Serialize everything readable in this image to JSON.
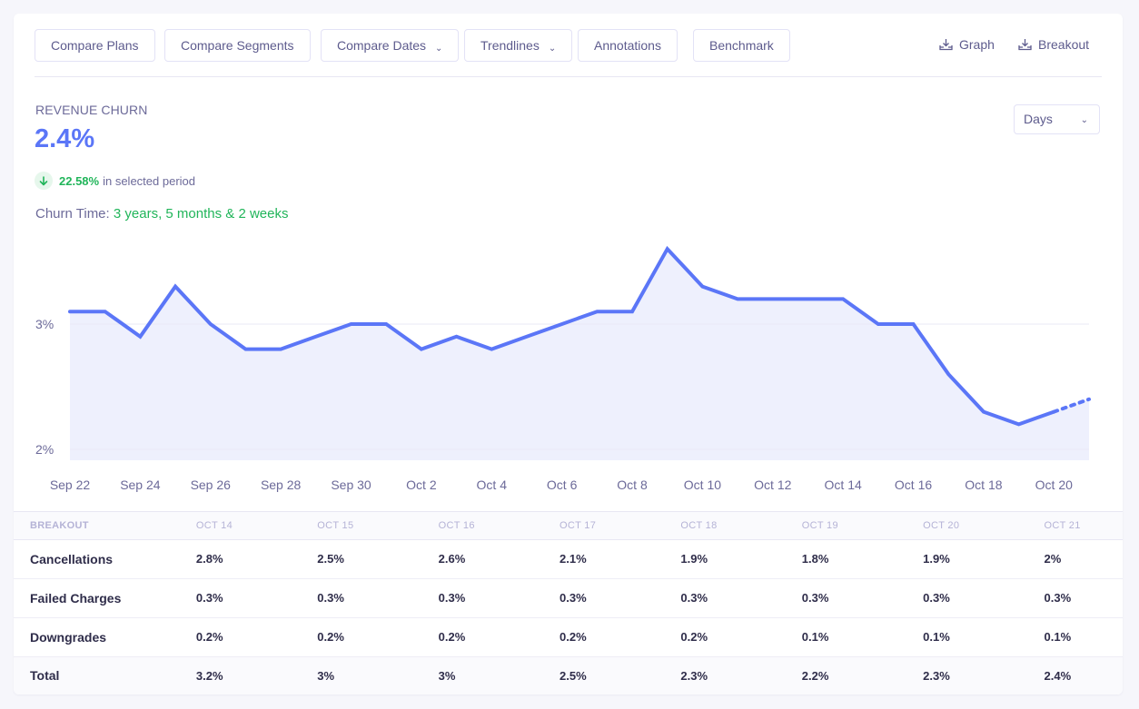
{
  "toolbar": {
    "buttons": [
      {
        "label": "Compare Plans",
        "dropdown": false
      },
      {
        "label": "Compare Segments",
        "dropdown": false
      },
      {
        "label": "Compare Dates",
        "dropdown": true
      },
      {
        "label": "Trendlines",
        "dropdown": true
      },
      {
        "label": "Annotations",
        "dropdown": false
      },
      {
        "label": "Benchmark",
        "dropdown": false
      }
    ],
    "downloads": [
      {
        "label": "Graph",
        "icon": "download-icon"
      },
      {
        "label": "Breakout",
        "icon": "download-icon"
      }
    ]
  },
  "metric": {
    "label": "REVENUE CHURN",
    "value": "2.4%",
    "change_pct": "22.58%",
    "change_direction": "down",
    "change_suffix": "in selected period",
    "churn_time_label": "Churn Time:",
    "churn_time_value": "3 years, 5 months & 2 weeks"
  },
  "period_select": {
    "value": "Days"
  },
  "colors": {
    "accent": "#5b76f7",
    "fill": "#eef0fd",
    "positive": "#21b55a",
    "text": "#5d5b8d"
  },
  "chart_data": {
    "type": "area",
    "title": "Revenue Churn",
    "xlabel": "",
    "ylabel": "",
    "ylim": [
      1.9,
      3.75
    ],
    "yticks": [
      {
        "value": 2,
        "label": "2%"
      },
      {
        "value": 3,
        "label": "3%"
      }
    ],
    "grid": true,
    "legend": "none",
    "x": [
      "Sep 22",
      "Sep 23",
      "Sep 24",
      "Sep 25",
      "Sep 26",
      "Sep 27",
      "Sep 28",
      "Sep 29",
      "Sep 30",
      "Oct 1",
      "Oct 2",
      "Oct 3",
      "Oct 4",
      "Oct 5",
      "Oct 6",
      "Oct 7",
      "Oct 8",
      "Oct 9",
      "Oct 10",
      "Oct 11",
      "Oct 12",
      "Oct 13",
      "Oct 14",
      "Oct 15",
      "Oct 16",
      "Oct 17",
      "Oct 18",
      "Oct 19",
      "Oct 20",
      "Oct 21"
    ],
    "xtick_labels": [
      "Sep 22",
      "Sep 24",
      "Sep 26",
      "Sep 28",
      "Sep 30",
      "Oct 2",
      "Oct 4",
      "Oct 6",
      "Oct 8",
      "Oct 10",
      "Oct 12",
      "Oct 14",
      "Oct 16",
      "Oct 18",
      "Oct 20"
    ],
    "series": [
      {
        "name": "Revenue Churn (%)",
        "values": [
          3.1,
          3.1,
          2.9,
          3.3,
          3.0,
          2.8,
          2.8,
          2.9,
          3.0,
          3.0,
          2.8,
          2.9,
          2.8,
          2.9,
          3.0,
          3.1,
          3.1,
          3.6,
          3.3,
          3.2,
          3.2,
          3.2,
          3.2,
          3.0,
          3.0,
          2.6,
          2.3,
          2.2,
          2.3,
          2.4
        ],
        "incomplete_last_point": true
      }
    ]
  },
  "breakout": {
    "header_label": "BREAKOUT",
    "columns": [
      "OCT 14",
      "OCT 15",
      "OCT 16",
      "OCT 17",
      "OCT 18",
      "OCT 19",
      "OCT 20",
      "OCT 21"
    ],
    "rows": [
      {
        "label": "Cancellations",
        "values": [
          "2.8%",
          "2.5%",
          "2.6%",
          "2.1%",
          "1.9%",
          "1.8%",
          "1.9%",
          "2%"
        ]
      },
      {
        "label": "Failed Charges",
        "values": [
          "0.3%",
          "0.3%",
          "0.3%",
          "0.3%",
          "0.3%",
          "0.3%",
          "0.3%",
          "0.3%"
        ]
      },
      {
        "label": "Downgrades",
        "values": [
          "0.2%",
          "0.2%",
          "0.2%",
          "0.2%",
          "0.2%",
          "0.1%",
          "0.1%",
          "0.1%"
        ]
      },
      {
        "label": "Total",
        "values": [
          "3.2%",
          "3%",
          "3%",
          "2.5%",
          "2.3%",
          "2.2%",
          "2.3%",
          "2.4%"
        ]
      }
    ]
  }
}
